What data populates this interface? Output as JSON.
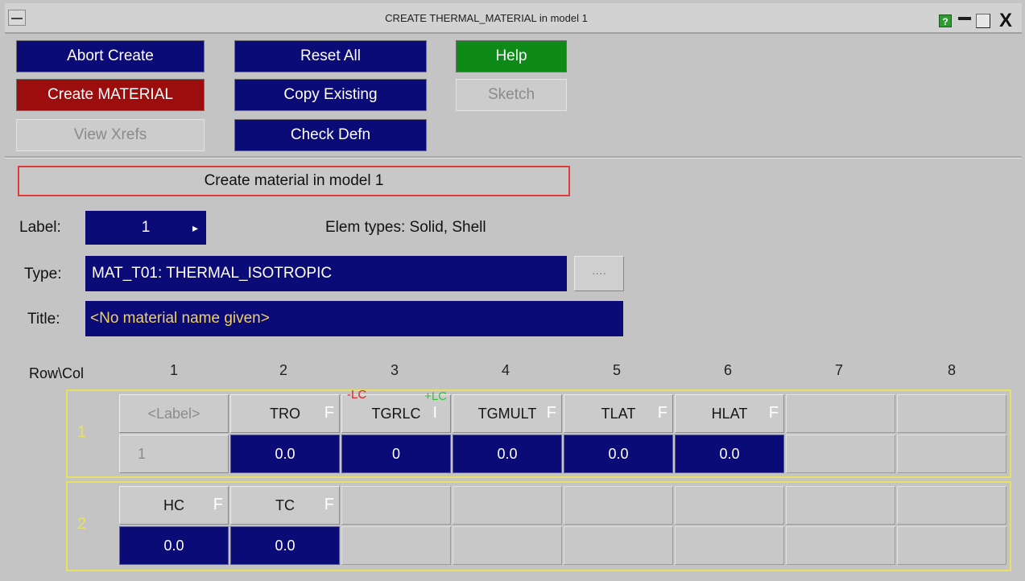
{
  "window": {
    "title": "CREATE THERMAL_MATERIAL in model 1",
    "help_icon": "?",
    "close_icon": "X"
  },
  "buttons": {
    "abort": "Abort Create",
    "create": "Create MATERIAL",
    "view_xrefs": "View Xrefs",
    "reset_all": "Reset All",
    "copy_existing": "Copy Existing",
    "check_defn": "Check Defn",
    "help": "Help",
    "sketch": "Sketch"
  },
  "status": "Create material in model 1",
  "form": {
    "label_caption": "Label:",
    "label_value": "1",
    "label_arrow": "▸",
    "elem_types": "Elem types: Solid, Shell",
    "type_caption": "Type:",
    "type_value": "MAT_T01: THERMAL_ISOTROPIC",
    "type_browse": "....",
    "title_caption": "Title:",
    "title_value": "<No material name given>"
  },
  "grid": {
    "corner_header": "Row\\Col",
    "columns": [
      "1",
      "2",
      "3",
      "4",
      "5",
      "6",
      "7",
      "8"
    ],
    "rows": [
      {
        "number": "1",
        "names": [
          "<Label>",
          "TRO",
          "TGRLC",
          "TGMULT",
          "TLAT",
          "HLAT",
          "",
          ""
        ],
        "values": [
          "1",
          "0.0",
          "0",
          "0.0",
          "0.0",
          "0.0",
          "",
          ""
        ]
      },
      {
        "number": "2",
        "names": [
          "HC",
          "TC",
          "",
          "",
          "",
          "",
          "",
          ""
        ],
        "values": [
          "0.0",
          "0.0",
          "",
          "",
          "",
          "",
          "",
          ""
        ]
      }
    ],
    "flag_f": "F",
    "flag_i": "I",
    "lc_red": "-LC",
    "lc_green": "+LC"
  },
  "colors": {
    "navy": "#0b0b78",
    "red": "#9c0e0e",
    "green": "#0e8a18",
    "row_outline": "#e8e060"
  }
}
